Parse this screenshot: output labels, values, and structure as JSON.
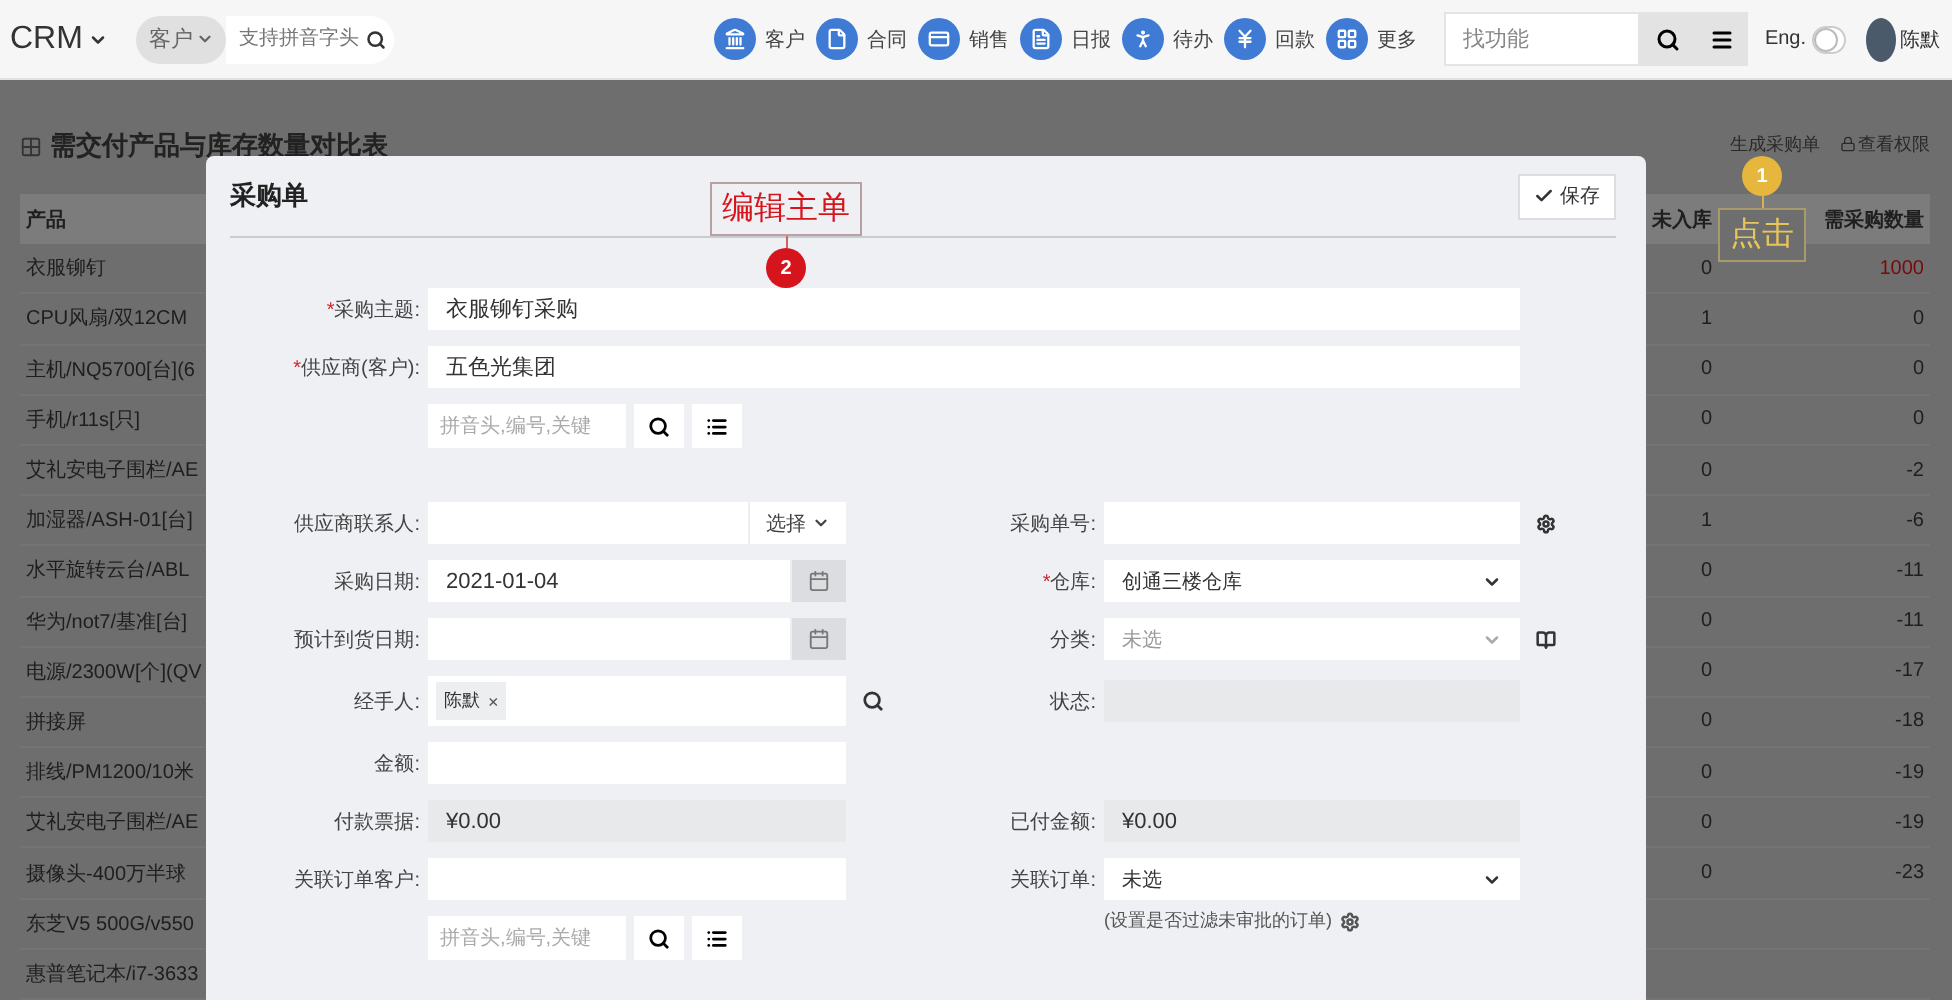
{
  "top_bar": {
    "brand": "CRM",
    "search_scope": "客户",
    "search_placeholder": "支持拼音字头",
    "nav": [
      {
        "kind": "bank",
        "label": "客户"
      },
      {
        "kind": "file",
        "label": "合同"
      },
      {
        "kind": "card",
        "label": "销售"
      },
      {
        "kind": "report",
        "label": "日报"
      },
      {
        "kind": "walk",
        "label": "待办"
      },
      {
        "kind": "yen",
        "label": "回款"
      },
      {
        "kind": "grid",
        "label": "更多"
      }
    ],
    "function_search_placeholder": "找功能",
    "language": {
      "label": "Eng.",
      "on": false
    },
    "user": "陈默"
  },
  "page": {
    "title": "需交付产品与库存数量对比表",
    "actions": [
      "生成采购单",
      "查看权限"
    ],
    "table": {
      "columns": [
        "产品",
        "未入库",
        "需采购数量"
      ],
      "rows": [
        {
          "product": "衣服铆钉",
          "pending": "0",
          "needed": "1000",
          "alert": true
        },
        {
          "product": "CPU风扇/双12CM",
          "pending": "1",
          "needed": "0",
          "alert": false
        },
        {
          "product": "主机/NQ5700[台](6",
          "pending": "0",
          "needed": "0",
          "alert": false
        },
        {
          "product": "手机/r11s[只]",
          "pending": "0",
          "needed": "0",
          "alert": false
        },
        {
          "product": "艾礼安电子围栏/AE",
          "pending": "0",
          "needed": "-2",
          "alert": false
        },
        {
          "product": "加湿器/ASH-01[台]",
          "pending": "1",
          "needed": "-6",
          "alert": false
        },
        {
          "product": "水平旋转云台/ABL",
          "pending": "0",
          "needed": "-11",
          "alert": false
        },
        {
          "product": "华为/not7/基准[台]",
          "pending": "0",
          "needed": "-11",
          "alert": false
        },
        {
          "product": "电源/2300W[个](QV",
          "pending": "0",
          "needed": "-17",
          "alert": false
        },
        {
          "product": "拼接屏",
          "pending": "0",
          "needed": "-18",
          "alert": false
        },
        {
          "product": "排线/PM1200/10米",
          "pending": "0",
          "needed": "-19",
          "alert": false
        },
        {
          "product": "艾礼安电子围栏/AE",
          "pending": "0",
          "needed": "-19",
          "alert": false
        },
        {
          "product": "摄像头-400万半球",
          "pending": "0",
          "needed": "-23",
          "alert": false
        },
        {
          "product": "东芝V5 500G/v550"
        },
        {
          "product": "惠普笔记本/i7-3633"
        }
      ]
    }
  },
  "annotation": {
    "number": "1",
    "label": "点击"
  },
  "dialog": {
    "title": "采购单",
    "save": "保存",
    "annotation": {
      "number": "2",
      "label": "编辑主单"
    },
    "main_fields": [
      {
        "kind": "text",
        "required_mark": "*",
        "label": "采购主题:",
        "value": "衣服铆钉采购"
      },
      {
        "kind": "text",
        "required_mark": "*",
        "label": "供应商(客户):",
        "value": "五色光集团"
      },
      {
        "kind": "lookup",
        "placeholder": "拼音头,编号,关键"
      }
    ],
    "rows": [
      {
        "left": {
          "kind": "picker",
          "label": "供应商联系人:",
          "button": "选择"
        },
        "right": {
          "kind": "serial",
          "label": "采购单号:"
        }
      },
      {
        "left": {
          "kind": "date",
          "label": "采购日期:",
          "value": "2021-01-04"
        },
        "right": {
          "kind": "select",
          "required_mark": "*",
          "label": "仓库:",
          "value": "创通三楼仓库"
        }
      },
      {
        "left": {
          "kind": "date",
          "label": "预计到货日期:"
        },
        "right": {
          "kind": "catalog",
          "label": "分类:",
          "placeholder": "未选"
        }
      },
      {
        "left": {
          "kind": "tags",
          "label": "经手人:",
          "tags": [
            "陈默"
          ],
          "remove": "×"
        },
        "right": {
          "kind": "readonly",
          "label": "状态:"
        }
      },
      {
        "left": {
          "kind": "text",
          "label": "金额:"
        }
      },
      {
        "left": {
          "kind": "readonly",
          "label": "付款票据:",
          "value": "¥0.00"
        },
        "right": {
          "kind": "readonly",
          "label": "已付金额:",
          "value": "¥0.00"
        }
      },
      {
        "left": {
          "kind": "text",
          "label": "关联订单客户:"
        },
        "right": {
          "kind": "select",
          "label": "关联订单:",
          "value": "未选"
        }
      },
      {
        "left": {
          "kind": "lookup",
          "placeholder": "拼音头,编号,关键"
        },
        "right": {
          "kind": "note",
          "text": "(设置是否过滤未审批的订单)"
        }
      }
    ]
  }
}
